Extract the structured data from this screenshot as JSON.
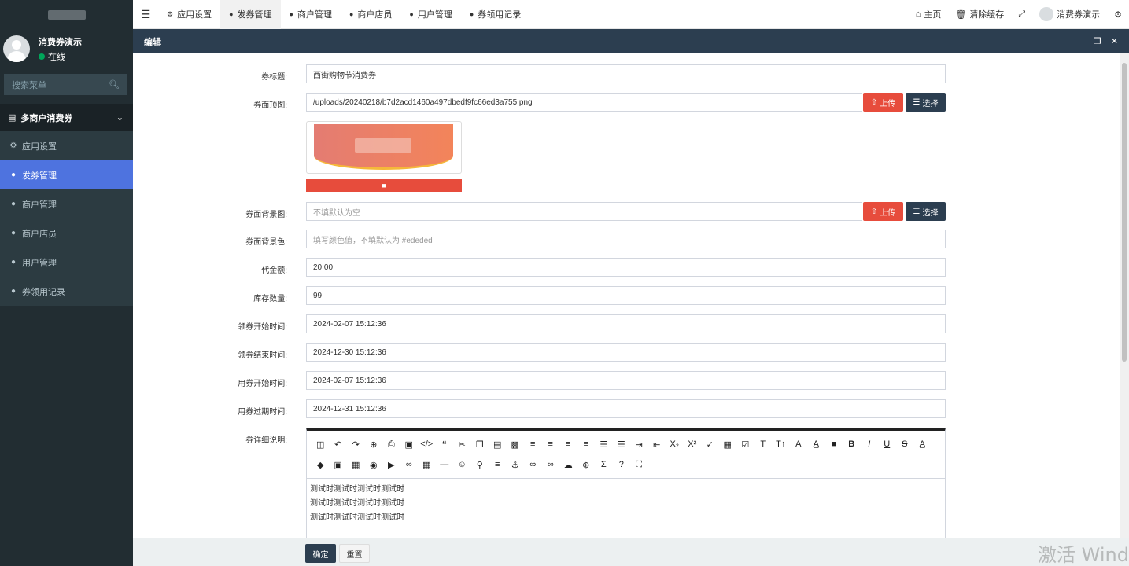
{
  "sidebar": {
    "user_name": "消费券演示",
    "user_status": "在线",
    "search_placeholder": "搜索菜单",
    "group_label": "多商户消费券",
    "items": [
      {
        "label": "应用设置",
        "icon": "gear-icon"
      },
      {
        "label": "发券管理",
        "icon": "comment-icon"
      },
      {
        "label": "商户管理",
        "icon": "comment-icon"
      },
      {
        "label": "商户店员",
        "icon": "comment-icon"
      },
      {
        "label": "用户管理",
        "icon": "comment-icon"
      },
      {
        "label": "券领用记录",
        "icon": "comment-icon"
      }
    ]
  },
  "topnav": {
    "tabs": [
      {
        "label": "应用设置",
        "icon": "gear-icon"
      },
      {
        "label": "发券管理",
        "icon": "comment-icon"
      },
      {
        "label": "商户管理",
        "icon": "comment-icon"
      },
      {
        "label": "商户店员",
        "icon": "comment-icon"
      },
      {
        "label": "用户管理",
        "icon": "comment-icon"
      },
      {
        "label": "券领用记录",
        "icon": "comment-icon"
      }
    ],
    "home": "主页",
    "clear_cache": "清除缓存",
    "user_name": "消费券演示"
  },
  "panel": {
    "title": "编辑"
  },
  "form": {
    "title_label": "券标题:",
    "title_value": "西街购物节消费券",
    "top_image_label": "券面顶图:",
    "top_image_value": "/uploads/20240218/b7d2acd1460a497dbedf9fc66ed3a755.png",
    "upload_label": "上传",
    "select_label": "选择",
    "bg_image_label": "券面背景图:",
    "bg_image_placeholder": "不填默认为空",
    "bg_color_label": "券面背景色:",
    "bg_color_placeholder": "填写颜色值，不填默认为 #ededed",
    "amount_label": "代金额:",
    "amount_value": "20.00",
    "stock_label": "库存数量:",
    "stock_value": "99",
    "claim_start_label": "领券开始时间:",
    "claim_start_value": "2024-02-07 15:12:36",
    "claim_end_label": "领券结束时间:",
    "claim_end_value": "2024-12-30 15:12:36",
    "use_start_label": "用券开始时间:",
    "use_start_value": "2024-02-07 15:12:36",
    "use_end_label": "用券过期时间:",
    "use_end_value": "2024-12-31 15:12:36",
    "detail_label": "券详细说明:",
    "detail_lines": [
      "测试时测试时测试时测试时",
      "测试时测试时测试时测试时",
      "测试时测试时测试时测试时"
    ]
  },
  "footer": {
    "confirm": "确定",
    "reset": "重置"
  },
  "watermark": "激活 Wind"
}
